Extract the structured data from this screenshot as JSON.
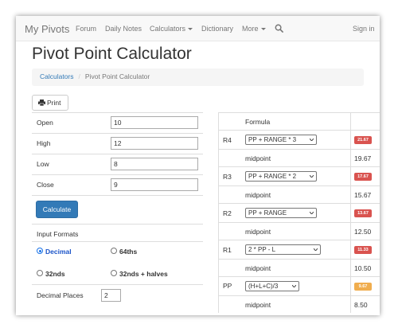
{
  "nav": {
    "brand": "My Pivots",
    "items": [
      "Forum",
      "Daily Notes",
      "Calculators",
      "Dictionary",
      "More"
    ],
    "sign_in": "Sign in"
  },
  "page_title": "Pivot Point Calculator",
  "breadcrumb": {
    "link": "Calculators",
    "separator": "/",
    "current": "Pivot Point Calculator"
  },
  "print_label": "Print",
  "form": {
    "fields": [
      {
        "label": "Open",
        "value": "10"
      },
      {
        "label": "High",
        "value": "12"
      },
      {
        "label": "Low",
        "value": "8"
      },
      {
        "label": "Close",
        "value": "9"
      }
    ],
    "calculate_label": "Calculate",
    "input_formats_label": "Input Formats",
    "formats": [
      "Decimal",
      "64ths",
      "32nds",
      "32nds + halves"
    ],
    "selected_format": "Decimal",
    "decimal_places_label": "Decimal Places",
    "decimal_places_value": "2"
  },
  "results": {
    "formula_header": "Formula",
    "midpoint_label": "midpoint",
    "rows": [
      {
        "label": "R4",
        "formula": "PP + RANGE * 3",
        "value": "21.67",
        "midpoint": "19.67",
        "color": "#d9534f"
      },
      {
        "label": "R3",
        "formula": "PP + RANGE * 2",
        "value": "17.67",
        "midpoint": "15.67",
        "color": "#d9534f"
      },
      {
        "label": "R2",
        "formula": "PP + RANGE",
        "value": "13.67",
        "midpoint": "12.50",
        "color": "#d9534f"
      },
      {
        "label": "R1",
        "formula": "2 * PP - L",
        "value": "11.33",
        "midpoint": "10.50",
        "color": "#d9534f"
      },
      {
        "label": "PP",
        "formula": "(H+L+C)/3",
        "value": "9.67",
        "midpoint": "8.50",
        "color": "#f0ad4e"
      }
    ]
  },
  "colors": {
    "link": "#337ab7",
    "button": "#337ab7",
    "resistance": "#d9534f",
    "pivot": "#f0ad4e"
  }
}
